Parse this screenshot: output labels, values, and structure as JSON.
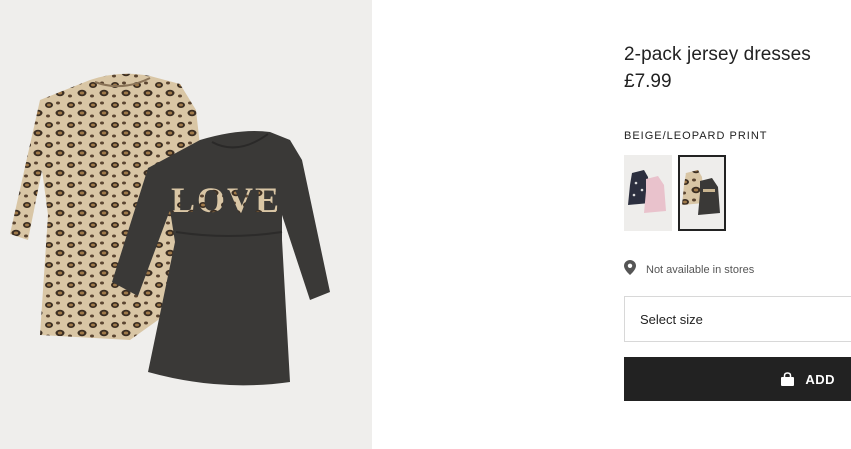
{
  "product": {
    "title": "2-pack jersey dresses",
    "price": "£7.99",
    "image_label": "LOVE"
  },
  "color": {
    "label": "BEIGE/LEOPARD PRINT",
    "swatches": [
      {
        "selected": false,
        "alt": "dark-blue-pink-dresses-swatch"
      },
      {
        "selected": true,
        "alt": "beige-leopard-dresses-swatch"
      }
    ]
  },
  "store": {
    "text": "Not available in stores",
    "icon": "location-pin-icon"
  },
  "size": {
    "placeholder": "Select size"
  },
  "add_button": {
    "label": "ADD",
    "icon": "shopping-bag-icon"
  },
  "colors": {
    "image_bg": "#efeeec",
    "dark_dress": "#3a3937",
    "leopard_base": "#d9c6a5",
    "button_bg": "#222222"
  }
}
